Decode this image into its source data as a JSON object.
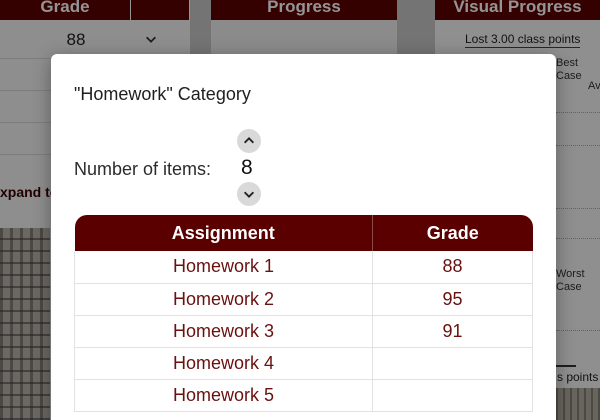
{
  "background": {
    "headers": {
      "grade": "Grade",
      "progress": "Progress",
      "visual_progress": "Visual Progress"
    },
    "grade_value": "88",
    "expand_text": "xpand to",
    "lost_text": "Lost 3.00 class points",
    "best_case": "Best\nCase",
    "avg_fragment": "Av",
    "worst_case": "Worst\nCase",
    "points_fragment": "s points"
  },
  "modal": {
    "title": "\"Homework\" Category",
    "items_label": "Number of items:",
    "items_value": "8",
    "table": {
      "headers": [
        "Assignment",
        "Grade"
      ],
      "rows": [
        {
          "assignment": "Homework 1",
          "grade": "88"
        },
        {
          "assignment": "Homework 2",
          "grade": "95"
        },
        {
          "assignment": "Homework 3",
          "grade": "91"
        },
        {
          "assignment": "Homework 4",
          "grade": ""
        },
        {
          "assignment": "Homework 5",
          "grade": ""
        }
      ]
    }
  },
  "icons": {
    "increment": "chevron-up-icon",
    "decrement": "chevron-down-icon",
    "background_dropdown": "chevron-down-icon"
  },
  "colors": {
    "accent": "#5a0000",
    "row_text": "#6b1010"
  }
}
